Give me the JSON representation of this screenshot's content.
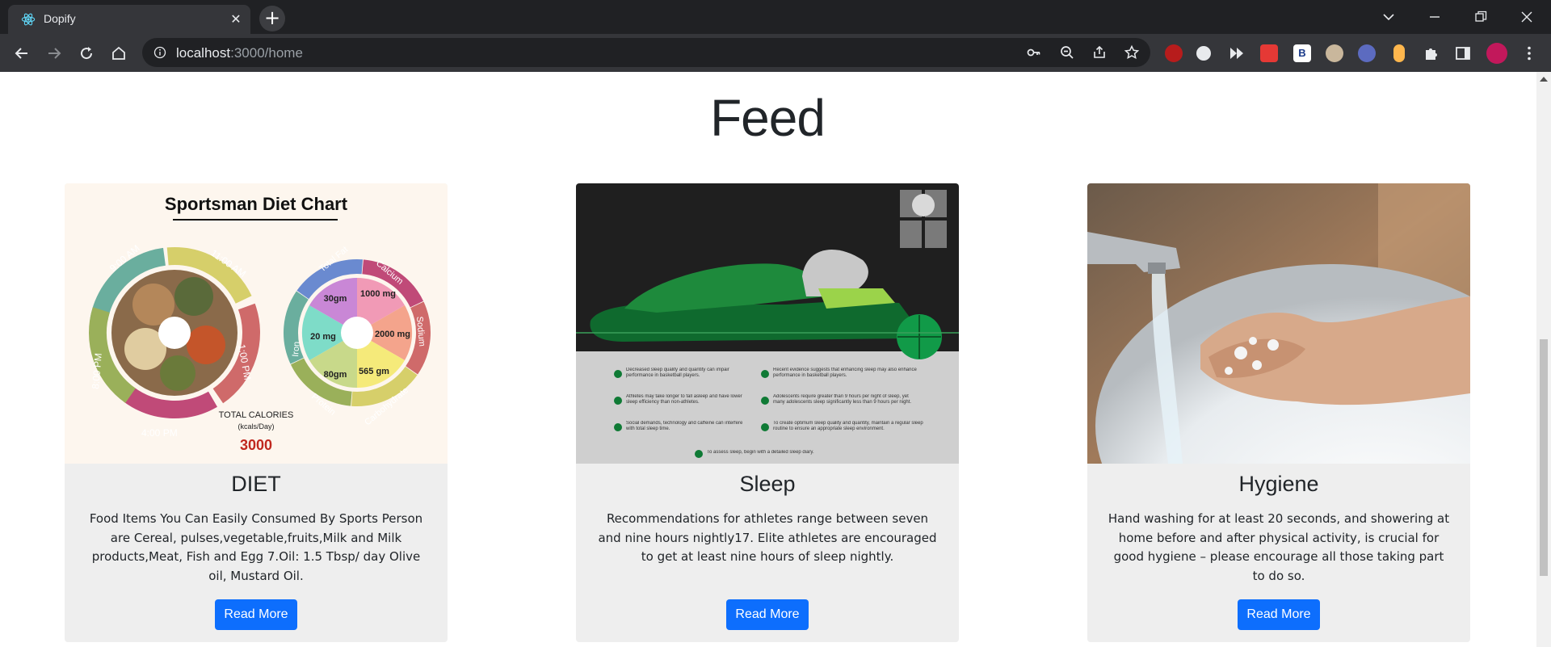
{
  "browser": {
    "tab_title": "Dopify",
    "url_host": "localhost",
    "url_rest": ":3000/home"
  },
  "page": {
    "heading": "Feed"
  },
  "cards": [
    {
      "title": "DIET",
      "text": "Food Items You Can Easily Consumed By Sports Person are Cereal, pulses,vegetable,fruits,Milk and Milk products,Meat, Fish and Egg 7.Oil: 1.5 Tbsp/ day Olive oil, Mustard Oil.",
      "button": "Read More",
      "image": {
        "heading": "Sportsman Diet Chart",
        "times": [
          "9:00 AM",
          "11:00 AM",
          "1:00 PM",
          "4:00 PM",
          "8:00 PM"
        ],
        "nutrients": [
          "Total Fat",
          "Calcium",
          "Sodium",
          "Carbohydrate",
          "Protein",
          "Iron"
        ],
        "amounts": [
          "30gm",
          "1000 mg",
          "2000 mg",
          "565 gm",
          "80gm",
          "20 mg"
        ],
        "calories_label": "TOTAL CALORIES",
        "calories_unit": "(kcals/Day)",
        "calories_value": "3000"
      }
    },
    {
      "title": "Sleep",
      "text": "Recommendations for athletes range between seven and nine hours nightly17. Elite athletes are encouraged to get at least nine hours of sleep nightly.",
      "button": "Read More",
      "image": {
        "bullets": [
          "Decreased sleep quality and quantity can impair performance in basketball players.",
          "Recent evidence suggests that enhancing sleep may also enhance performance in basketball players.",
          "Athletes may take longer to fall asleep and have lower sleep efficiency than non-athletes.",
          "Adolescents require greater than 9 hours per night of sleep, yet many adolescents sleep significantly less than 9 hours per night.",
          "Social demands, technology and caffeine can interfere with total sleep time.",
          "To create optimum sleep quality and quantity, maintain a regular sleep routine to ensure an appropriate sleep environment."
        ],
        "footer": "To assess sleep, begin with a detailed sleep diary."
      }
    },
    {
      "title": "Hygiene",
      "text": "Hand washing for at least 20 seconds, and showering at home before and after physical activity, is crucial for good hygiene – please encourage all those taking part to do so.",
      "button": "Read More"
    }
  ],
  "colors": {
    "primary_button": "#0d6efd",
    "card_bg": "#eeeeee",
    "chrome_dark": "#202124",
    "chrome_toolbar": "#35363a"
  }
}
